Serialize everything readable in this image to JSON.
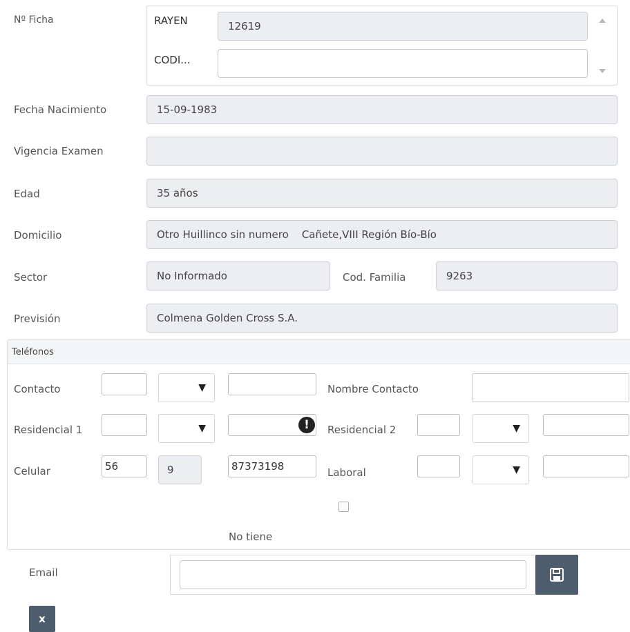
{
  "ficha": {
    "label": "Nº Ficha",
    "rows": [
      {
        "code": "RAYEN",
        "value": "12619"
      },
      {
        "code": "CODI...",
        "value": ""
      }
    ]
  },
  "fields": {
    "fecha_nacimiento": {
      "label": "Fecha Nacimiento",
      "value": "15-09-1983"
    },
    "vigencia_examen": {
      "label": "Vigencia Examen",
      "value": ""
    },
    "edad": {
      "label": "Edad",
      "value": "35 años"
    },
    "domicilio": {
      "label": "Domicilio",
      "value": "Otro Huillinco sin numero    Cañete,VIII Región Bío-Bío"
    },
    "sector": {
      "label": "Sector",
      "value": "No Informado"
    },
    "cod_familia": {
      "label": "Cod. Familia",
      "value": "9263"
    },
    "prevision": {
      "label": "Previsión",
      "value": "Colmena Golden Cross S.A."
    }
  },
  "telefonos": {
    "title": "Teléfonos",
    "contacto": {
      "label": "Contacto",
      "code": "",
      "prefix": "",
      "number": ""
    },
    "nombre_contacto": {
      "label": "Nombre Contacto",
      "value": ""
    },
    "residencial1": {
      "label": "Residencial 1",
      "code": "",
      "prefix": "",
      "number": ""
    },
    "residencial2": {
      "label": "Residencial 2",
      "code": "",
      "prefix": "",
      "number": ""
    },
    "celular": {
      "label": "Celular",
      "code": "56",
      "prefix": "9",
      "number": "87373198"
    },
    "laboral": {
      "label": "Laboral",
      "code": "",
      "prefix": "",
      "number": ""
    },
    "no_tiene": {
      "label": "No tiene",
      "checked": false
    },
    "select_arrow": "▼"
  },
  "email": {
    "label": "Email",
    "value": ""
  },
  "close": {
    "label": "x"
  },
  "icons": {
    "warning": "exclamation-circle-icon",
    "save": "floppy-disk-icon",
    "scroll_up": "caret-up",
    "scroll_down": "caret-down"
  },
  "colors": {
    "readonly_bg": "#eceef1",
    "button_bg": "#4d5d6e"
  }
}
